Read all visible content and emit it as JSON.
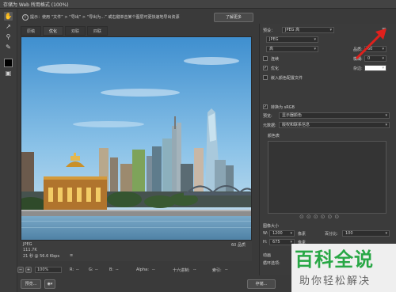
{
  "window": {
    "title": "存储为 Web 所用格式 (100%)"
  },
  "toolbar": {
    "tools": [
      "hand-tool",
      "slice-select-tool",
      "zoom-tool",
      "eyedropper-tool",
      "eyedropper-color",
      "slice-visibility-tool"
    ]
  },
  "hint": {
    "text": "提示：使用 “文件” > “导出” > “导出为…” 或右键单击某个图层可更快速地导出资源",
    "learn_more": "了解更多"
  },
  "tabs": [
    {
      "label": "原稿"
    },
    {
      "label": "优化"
    },
    {
      "label": "双联"
    },
    {
      "label": "四联"
    }
  ],
  "preview_info": {
    "format": "JPEG",
    "size": "111.7K",
    "time": "21 秒 @ 56.6 Kbps",
    "menu": "≡",
    "quality": "60 品质"
  },
  "statusbar": {
    "zoom": "100%",
    "r_label": "R:",
    "g_label": "G:",
    "b_label": "B:",
    "alpha_label": "Alpha:",
    "hex_label": "十六进制:",
    "index_label": "索引:",
    "r_value": "--",
    "g_value": "--",
    "b_value": "--",
    "alpha_value": "--",
    "hex_value": "--",
    "index_value": "--"
  },
  "bottom": {
    "preview_button": "预览...",
    "save_button": "存储..."
  },
  "panel": {
    "preset_label": "预设：",
    "preset_value": "JPEG 高",
    "format_value": "JPEG",
    "quality_level": "高",
    "quality_label": "品质:",
    "quality_value": "60",
    "progressive_label": "连续",
    "blur_label": "模糊:",
    "blur_value": "0",
    "optimized_label": "优化",
    "matte_label": "杂边:",
    "embed_profile_label": "嵌入颜色配置文件",
    "convert_srgb_label": "转换为 sRGB",
    "preview_label": "预览:",
    "preview_value": "显示器颜色",
    "metadata_label": "元数据:",
    "metadata_value": "版权和联系信息",
    "color_table_label": "颜色表",
    "image_size_label": "图像大小",
    "width_label": "W:",
    "width_value": "1200",
    "height_label": "H:",
    "height_value": "675",
    "unit": "像素",
    "percent_label": "百分比:",
    "percent_value": "100",
    "animation_label": "动画",
    "loop_label": "循环选项:"
  },
  "watermark": {
    "logo": "百科全说",
    "sub": "助你轻松解决"
  },
  "colors": {
    "accent_arrow": "#e0201c",
    "watermark_green": "#28a745"
  }
}
